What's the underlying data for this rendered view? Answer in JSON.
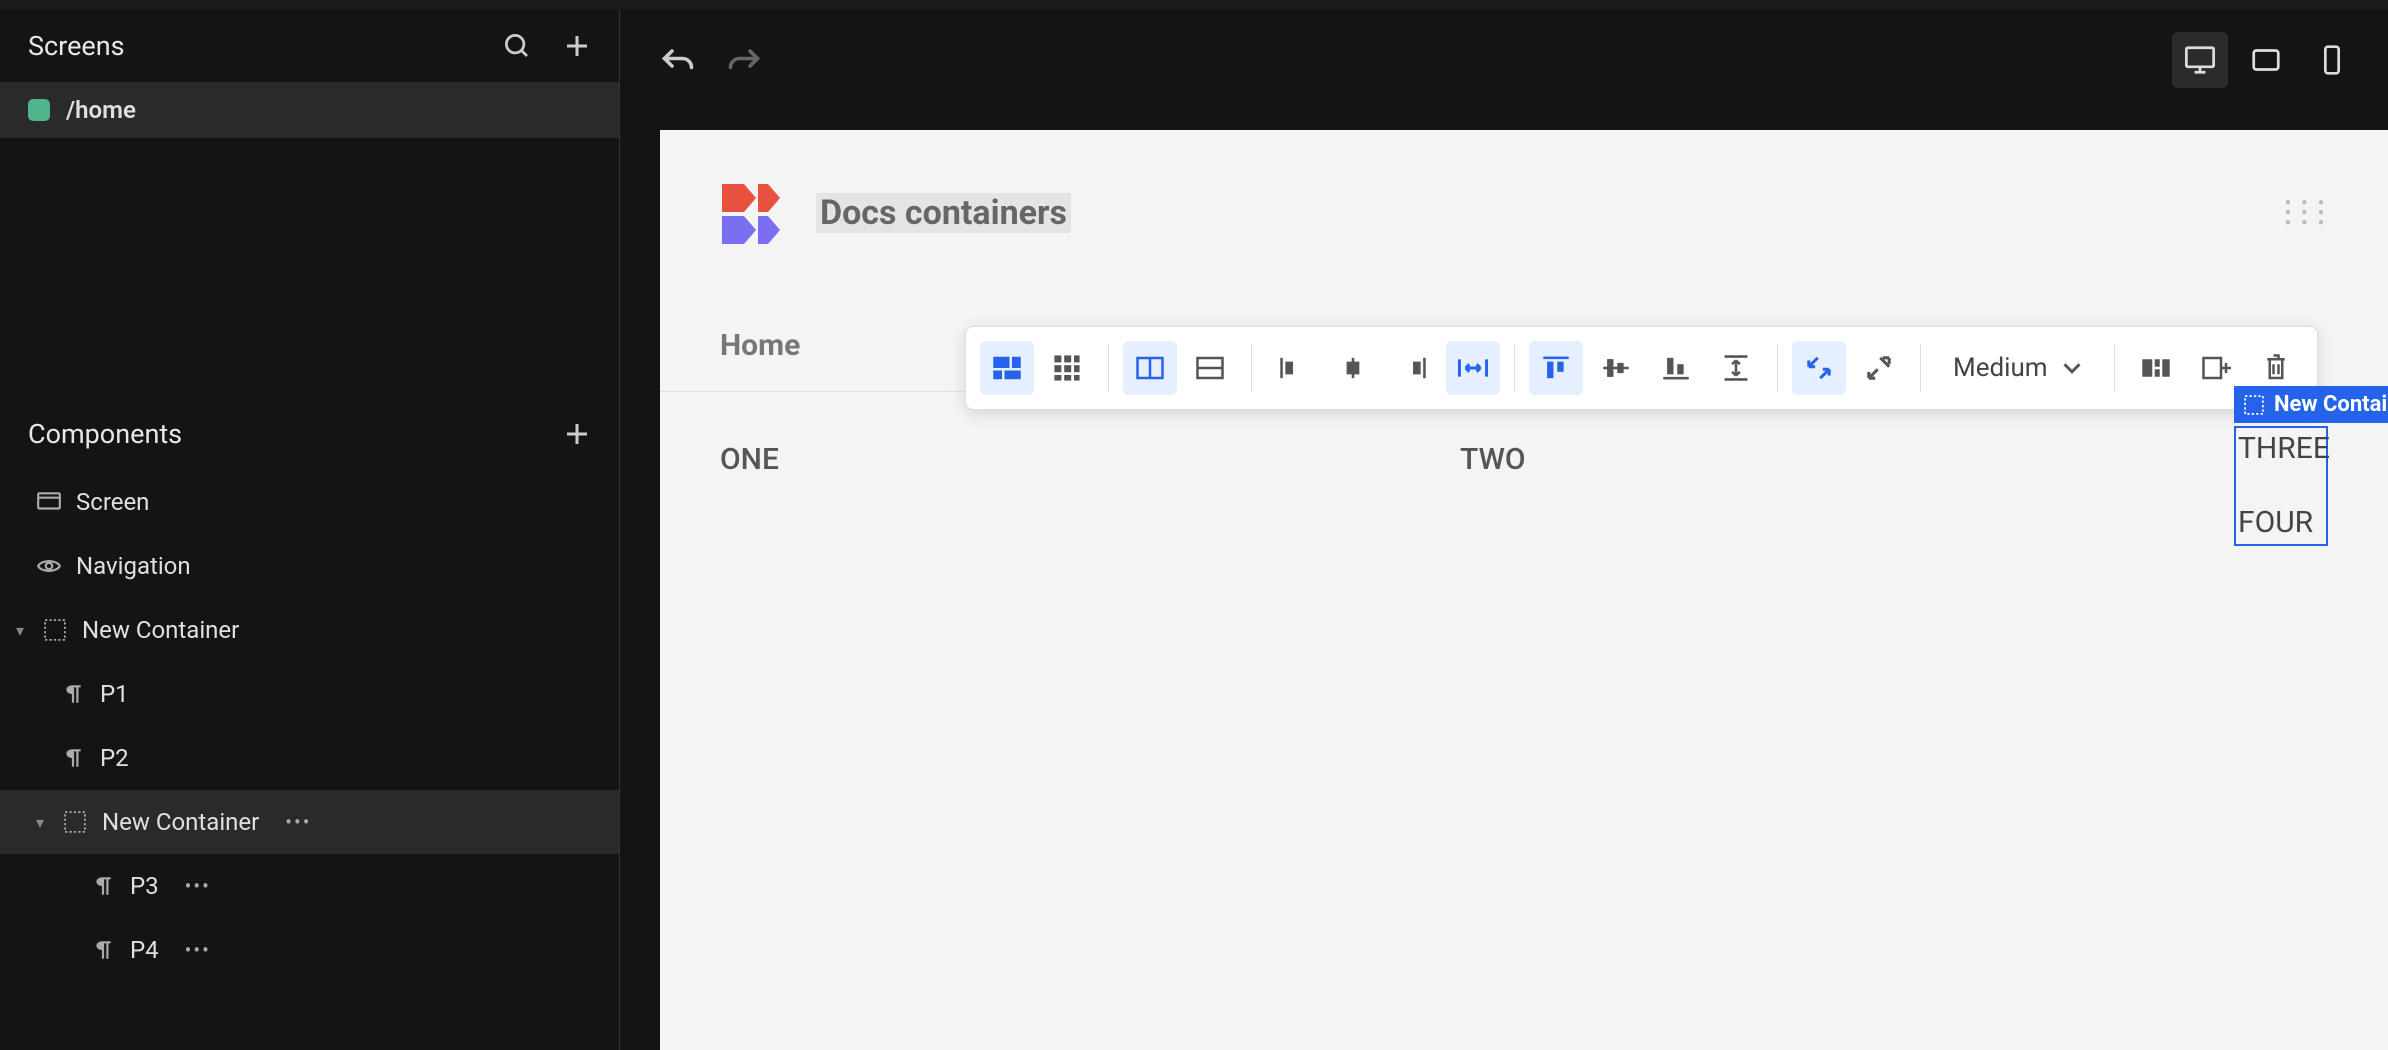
{
  "sidebar": {
    "screens_label": "Screens",
    "screen_item": "/home",
    "components_label": "Components",
    "tree": {
      "screen": "Screen",
      "navigation": "Navigation",
      "container1": "New Container",
      "p1": "P1",
      "p2": "P2",
      "container2": "New Container",
      "p3": "P3",
      "p4": "P4"
    }
  },
  "toolbar": {
    "size_label": "Medium"
  },
  "canvas": {
    "app_title": "Docs containers",
    "breadcrumb": "Home",
    "columns": {
      "one": "ONE",
      "two": "TWO",
      "three": "THREE",
      "four": "FOUR"
    },
    "selection_label": "New Contai"
  }
}
